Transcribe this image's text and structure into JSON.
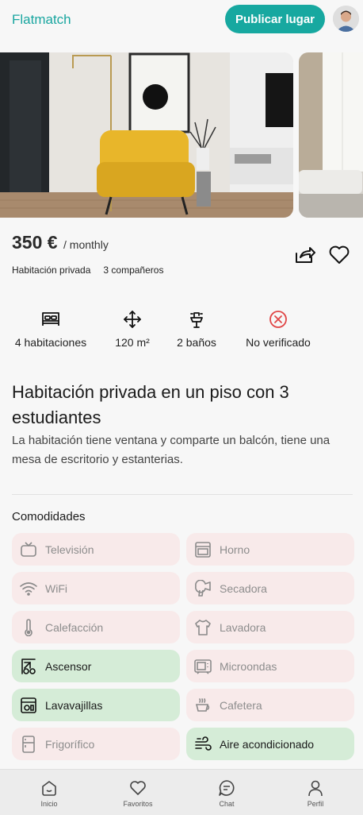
{
  "header": {
    "brand": "Flatmatch",
    "publish_label": "Publicar lugar"
  },
  "listing": {
    "price": "350 €",
    "period": "/ monthly",
    "tags": [
      "Habitación privada",
      "3 compañeros"
    ],
    "features": [
      {
        "icon": "bed-icon",
        "label": "4 habitaciones"
      },
      {
        "icon": "area-arrows-icon",
        "label": "120 m²"
      },
      {
        "icon": "sink-icon",
        "label": "2 baños"
      },
      {
        "icon": "not-verified-icon",
        "label": "No verificado"
      }
    ],
    "title": "Habitación privada en un piso con 3 estudiantes",
    "description": "La habitación tiene ventana y comparte un balcón, tiene una mesa de escritorio y estanterias."
  },
  "amenities": {
    "title": "Comodidades",
    "items": [
      {
        "label": "Televisión",
        "icon": "tv-icon",
        "available": false
      },
      {
        "label": "Horno",
        "icon": "oven-icon",
        "available": false
      },
      {
        "label": "WiFi",
        "icon": "wifi-icon",
        "available": false
      },
      {
        "label": "Secadora",
        "icon": "hair-dryer-icon",
        "available": false
      },
      {
        "label": "Calefacción",
        "icon": "thermometer-icon",
        "available": false
      },
      {
        "label": "Lavadora",
        "icon": "shirt-icon",
        "available": false
      },
      {
        "label": "Ascensor",
        "icon": "elevator-icon",
        "available": true
      },
      {
        "label": "Microondas",
        "icon": "microwave-icon",
        "available": false
      },
      {
        "label": "Lavavajillas",
        "icon": "dishwasher-icon",
        "available": true
      },
      {
        "label": "Cafetera",
        "icon": "coffee-cup-icon",
        "available": false
      },
      {
        "label": "Frigorífico",
        "icon": "fridge-icon",
        "available": false
      },
      {
        "label": "Aire acondicionado",
        "icon": "air-conditioning-icon",
        "available": true
      }
    ]
  },
  "nav": [
    {
      "label": "Inicio",
      "icon": "home-icon"
    },
    {
      "label": "Favoritos",
      "icon": "heart-icon"
    },
    {
      "label": "Chat",
      "icon": "chat-icon"
    },
    {
      "label": "Perfil",
      "icon": "user-icon"
    }
  ],
  "colors": {
    "accent": "#17a8a0",
    "available_bg": "#d5ecd7",
    "unavailable_bg": "#f8eaea",
    "error": "#e04646"
  }
}
